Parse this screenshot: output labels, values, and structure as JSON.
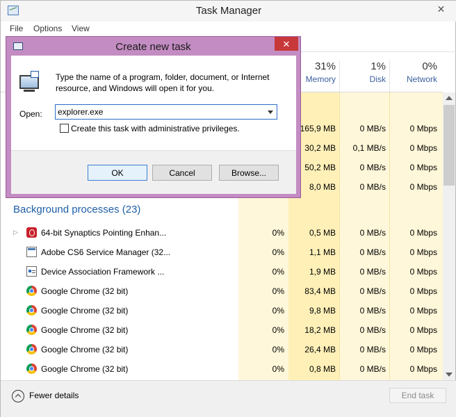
{
  "window": {
    "title": "Task Manager",
    "close_glyph": "✕"
  },
  "menu": {
    "items": [
      "File",
      "Options",
      "View"
    ]
  },
  "columns": {
    "memory": {
      "pct": "31%",
      "label": "Memory"
    },
    "disk": {
      "pct": "1%",
      "label": "Disk"
    },
    "network": {
      "pct": "0%",
      "label": "Network"
    }
  },
  "top_rows": [
    {
      "memory": "165,9 MB",
      "disk": "0 MB/s",
      "network": "0 Mbps"
    },
    {
      "memory": "30,2 MB",
      "disk": "0,1 MB/s",
      "network": "0 Mbps"
    },
    {
      "memory": "50,2 MB",
      "disk": "0 MB/s",
      "network": "0 Mbps"
    },
    {
      "memory": "8,0 MB",
      "disk": "0 MB/s",
      "network": "0 Mbps"
    }
  ],
  "background": {
    "title": "Background processes (23)",
    "rows": [
      {
        "name": "64-bit Synaptics Pointing Enhan...",
        "icon": "synaptics-icon",
        "expandable": true,
        "cpu": "0%",
        "memory": "0,5 MB",
        "disk": "0 MB/s",
        "network": "0 Mbps"
      },
      {
        "name": "Adobe CS6 Service Manager (32...",
        "icon": "generic-app-icon",
        "expandable": false,
        "cpu": "0%",
        "memory": "1,1 MB",
        "disk": "0 MB/s",
        "network": "0 Mbps"
      },
      {
        "name": "Device Association Framework ...",
        "icon": "device-icon",
        "expandable": false,
        "cpu": "0%",
        "memory": "1,9 MB",
        "disk": "0 MB/s",
        "network": "0 Mbps"
      },
      {
        "name": "Google Chrome (32 bit)",
        "icon": "chrome-icon",
        "expandable": false,
        "cpu": "0%",
        "memory": "83,4 MB",
        "disk": "0 MB/s",
        "network": "0 Mbps"
      },
      {
        "name": "Google Chrome (32 bit)",
        "icon": "chrome-icon",
        "expandable": false,
        "cpu": "0%",
        "memory": "9,8 MB",
        "disk": "0 MB/s",
        "network": "0 Mbps"
      },
      {
        "name": "Google Chrome (32 bit)",
        "icon": "chrome-icon",
        "expandable": false,
        "cpu": "0%",
        "memory": "18,2 MB",
        "disk": "0 MB/s",
        "network": "0 Mbps"
      },
      {
        "name": "Google Chrome (32 bit)",
        "icon": "chrome-icon",
        "expandable": false,
        "cpu": "0%",
        "memory": "26,4 MB",
        "disk": "0 MB/s",
        "network": "0 Mbps"
      },
      {
        "name": "Google Chrome (32 bit)",
        "icon": "chrome-icon",
        "expandable": false,
        "cpu": "0%",
        "memory": "0,8 MB",
        "disk": "0 MB/s",
        "network": "0 Mbps"
      }
    ]
  },
  "footer": {
    "fewer_details": "Fewer details",
    "end_task": "End task"
  },
  "dialog": {
    "title": "Create new task",
    "close_glyph": "✕",
    "description": "Type the name of a program, folder, document, or Internet resource, and Windows will open it for you.",
    "open_label": "Open:",
    "open_value": "explorer.exe",
    "admin_label": "Create this task with administrative privileges.",
    "admin_checked": false,
    "ok": "OK",
    "cancel": "Cancel",
    "browse": "Browse..."
  },
  "colors": {
    "dialog_frame": "#c38cc2",
    "close_red": "#c7383a",
    "section_blue": "#1e5ea8",
    "heat_yellow": "#fff7d9"
  }
}
